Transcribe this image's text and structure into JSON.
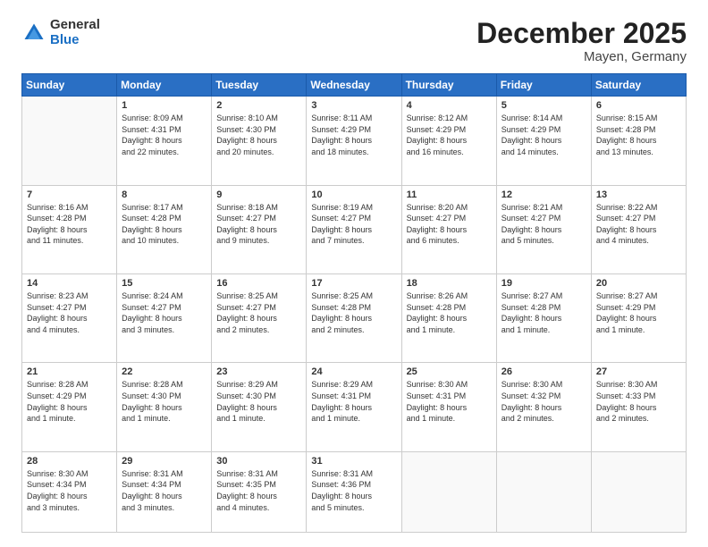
{
  "logo": {
    "general": "General",
    "blue": "Blue"
  },
  "header": {
    "month": "December 2025",
    "location": "Mayen, Germany"
  },
  "weekdays": [
    "Sunday",
    "Monday",
    "Tuesday",
    "Wednesday",
    "Thursday",
    "Friday",
    "Saturday"
  ],
  "weeks": [
    [
      {
        "day": "",
        "info": ""
      },
      {
        "day": "1",
        "info": "Sunrise: 8:09 AM\nSunset: 4:31 PM\nDaylight: 8 hours\nand 22 minutes."
      },
      {
        "day": "2",
        "info": "Sunrise: 8:10 AM\nSunset: 4:30 PM\nDaylight: 8 hours\nand 20 minutes."
      },
      {
        "day": "3",
        "info": "Sunrise: 8:11 AM\nSunset: 4:29 PM\nDaylight: 8 hours\nand 18 minutes."
      },
      {
        "day": "4",
        "info": "Sunrise: 8:12 AM\nSunset: 4:29 PM\nDaylight: 8 hours\nand 16 minutes."
      },
      {
        "day": "5",
        "info": "Sunrise: 8:14 AM\nSunset: 4:29 PM\nDaylight: 8 hours\nand 14 minutes."
      },
      {
        "day": "6",
        "info": "Sunrise: 8:15 AM\nSunset: 4:28 PM\nDaylight: 8 hours\nand 13 minutes."
      }
    ],
    [
      {
        "day": "7",
        "info": "Sunrise: 8:16 AM\nSunset: 4:28 PM\nDaylight: 8 hours\nand 11 minutes."
      },
      {
        "day": "8",
        "info": "Sunrise: 8:17 AM\nSunset: 4:28 PM\nDaylight: 8 hours\nand 10 minutes."
      },
      {
        "day": "9",
        "info": "Sunrise: 8:18 AM\nSunset: 4:27 PM\nDaylight: 8 hours\nand 9 minutes."
      },
      {
        "day": "10",
        "info": "Sunrise: 8:19 AM\nSunset: 4:27 PM\nDaylight: 8 hours\nand 7 minutes."
      },
      {
        "day": "11",
        "info": "Sunrise: 8:20 AM\nSunset: 4:27 PM\nDaylight: 8 hours\nand 6 minutes."
      },
      {
        "day": "12",
        "info": "Sunrise: 8:21 AM\nSunset: 4:27 PM\nDaylight: 8 hours\nand 5 minutes."
      },
      {
        "day": "13",
        "info": "Sunrise: 8:22 AM\nSunset: 4:27 PM\nDaylight: 8 hours\nand 4 minutes."
      }
    ],
    [
      {
        "day": "14",
        "info": "Sunrise: 8:23 AM\nSunset: 4:27 PM\nDaylight: 8 hours\nand 4 minutes."
      },
      {
        "day": "15",
        "info": "Sunrise: 8:24 AM\nSunset: 4:27 PM\nDaylight: 8 hours\nand 3 minutes."
      },
      {
        "day": "16",
        "info": "Sunrise: 8:25 AM\nSunset: 4:27 PM\nDaylight: 8 hours\nand 2 minutes."
      },
      {
        "day": "17",
        "info": "Sunrise: 8:25 AM\nSunset: 4:28 PM\nDaylight: 8 hours\nand 2 minutes."
      },
      {
        "day": "18",
        "info": "Sunrise: 8:26 AM\nSunset: 4:28 PM\nDaylight: 8 hours\nand 1 minute."
      },
      {
        "day": "19",
        "info": "Sunrise: 8:27 AM\nSunset: 4:28 PM\nDaylight: 8 hours\nand 1 minute."
      },
      {
        "day": "20",
        "info": "Sunrise: 8:27 AM\nSunset: 4:29 PM\nDaylight: 8 hours\nand 1 minute."
      }
    ],
    [
      {
        "day": "21",
        "info": "Sunrise: 8:28 AM\nSunset: 4:29 PM\nDaylight: 8 hours\nand 1 minute."
      },
      {
        "day": "22",
        "info": "Sunrise: 8:28 AM\nSunset: 4:30 PM\nDaylight: 8 hours\nand 1 minute."
      },
      {
        "day": "23",
        "info": "Sunrise: 8:29 AM\nSunset: 4:30 PM\nDaylight: 8 hours\nand 1 minute."
      },
      {
        "day": "24",
        "info": "Sunrise: 8:29 AM\nSunset: 4:31 PM\nDaylight: 8 hours\nand 1 minute."
      },
      {
        "day": "25",
        "info": "Sunrise: 8:30 AM\nSunset: 4:31 PM\nDaylight: 8 hours\nand 1 minute."
      },
      {
        "day": "26",
        "info": "Sunrise: 8:30 AM\nSunset: 4:32 PM\nDaylight: 8 hours\nand 2 minutes."
      },
      {
        "day": "27",
        "info": "Sunrise: 8:30 AM\nSunset: 4:33 PM\nDaylight: 8 hours\nand 2 minutes."
      }
    ],
    [
      {
        "day": "28",
        "info": "Sunrise: 8:30 AM\nSunset: 4:34 PM\nDaylight: 8 hours\nand 3 minutes."
      },
      {
        "day": "29",
        "info": "Sunrise: 8:31 AM\nSunset: 4:34 PM\nDaylight: 8 hours\nand 3 minutes."
      },
      {
        "day": "30",
        "info": "Sunrise: 8:31 AM\nSunset: 4:35 PM\nDaylight: 8 hours\nand 4 minutes."
      },
      {
        "day": "31",
        "info": "Sunrise: 8:31 AM\nSunset: 4:36 PM\nDaylight: 8 hours\nand 5 minutes."
      },
      {
        "day": "",
        "info": ""
      },
      {
        "day": "",
        "info": ""
      },
      {
        "day": "",
        "info": ""
      }
    ]
  ]
}
